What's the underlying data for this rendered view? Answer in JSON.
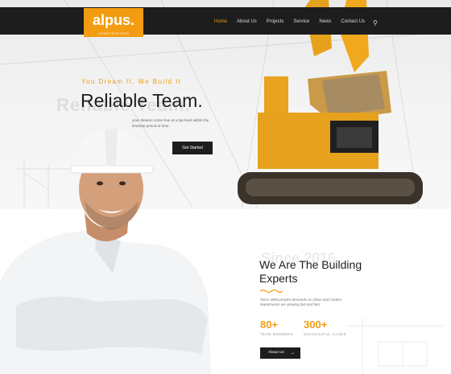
{
  "brand": {
    "logo_text": "alpus.",
    "tagline": "CONSTRUCTION"
  },
  "nav": {
    "items": [
      "Home",
      "About Us",
      "Projects",
      "Service",
      "News",
      "Contact Us"
    ],
    "active_index": 0
  },
  "hero": {
    "eyebrow": "You Dream It, We Build It",
    "ghost_text": "Reliable Team.",
    "title": "Reliable Team.",
    "description": "your dreams come true at a top level within the shortest period of time.",
    "cta": "Get Started"
  },
  "about": {
    "ghost_text": "Since 2016",
    "title": "We Are The Building Experts",
    "description": "Since 1995 peoples demands on urban and modern departments are growing fast and fast.",
    "stats": [
      {
        "value": "80+",
        "label": "TEAM MEMBERS"
      },
      {
        "value": "300+",
        "label": "SUCCESSFUL CASES"
      }
    ],
    "cta": "About Us"
  },
  "colors": {
    "accent": "#f39c12",
    "dark": "#1d1d1d"
  }
}
